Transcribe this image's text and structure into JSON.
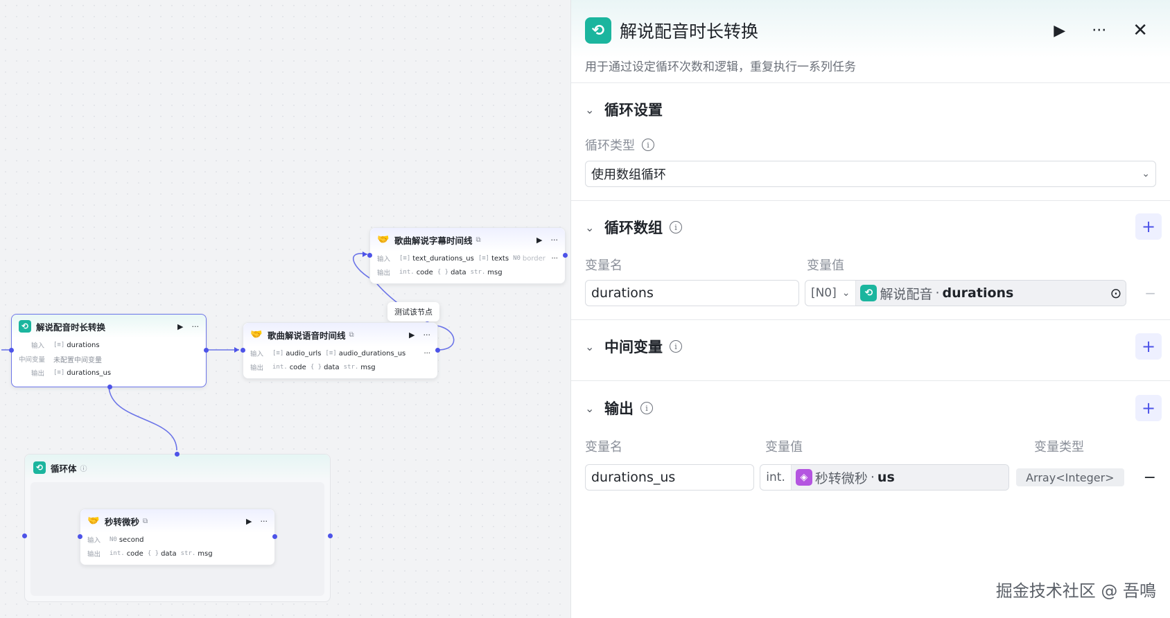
{
  "canvas": {
    "tooltip": "测试该节点",
    "nodes": {
      "subtitle": {
        "title": "歌曲解说字幕时间线",
        "in_label": "输入",
        "out_label": "输出",
        "inputs": [
          {
            "type": "[≡]",
            "name": "text_durations_us"
          },
          {
            "type": "[≡]",
            "name": "texts"
          },
          {
            "type": "N0",
            "name": "border"
          }
        ],
        "outputs": [
          {
            "type": "int.",
            "name": "code"
          },
          {
            "type": "{ }",
            "name": "data"
          },
          {
            "type": "str.",
            "name": "msg"
          }
        ]
      },
      "loop": {
        "title": "解说配音时长转换",
        "in_label": "输入",
        "mid_label": "中间变量",
        "out_label": "输出",
        "input": {
          "type": "[≡]",
          "name": "durations"
        },
        "mid_value": "未配置中间变量",
        "output": {
          "type": "[≡]",
          "name": "durations_us"
        }
      },
      "voice": {
        "title": "歌曲解说语音时间线",
        "in_label": "输入",
        "out_label": "输出",
        "inputs": [
          {
            "type": "[≡]",
            "name": "audio_urls"
          },
          {
            "type": "[≡]",
            "name": "audio_durations_us"
          }
        ],
        "outputs": [
          {
            "type": "int.",
            "name": "code"
          },
          {
            "type": "{ }",
            "name": "data"
          },
          {
            "type": "str.",
            "name": "msg"
          }
        ]
      },
      "loop_body": {
        "title": "循环体"
      },
      "sec2us": {
        "title": "秒转微秒",
        "in_label": "输入",
        "out_label": "输出",
        "input": {
          "type": "N0",
          "name": "second"
        },
        "outputs": [
          {
            "type": "int.",
            "name": "code"
          },
          {
            "type": "{ }",
            "name": "data"
          },
          {
            "type": "str.",
            "name": "msg"
          }
        ]
      }
    }
  },
  "panel": {
    "title": "解说配音时长转换",
    "description": "用于通过设定循环次数和逻辑，重复执行一系列任务",
    "loop_settings": {
      "title": "循环设置",
      "type_label": "循环类型",
      "type_value": "使用数组循环"
    },
    "loop_array": {
      "title": "循环数组",
      "col_name": "变量名",
      "col_value": "变量值",
      "var_name": "durations",
      "ref_type": "[N0]",
      "ref_source": "解说配音",
      "ref_sep": " · ",
      "ref_field": "durations"
    },
    "intermediate": {
      "title": "中间变量"
    },
    "output": {
      "title": "输出",
      "col_name": "变量名",
      "col_value": "变量值",
      "col_type": "变量类型",
      "var_name": "durations_us",
      "ref_type": "int.",
      "ref_source": "秒转微秒",
      "ref_sep": " · ",
      "ref_field": "us",
      "var_type": "Array<Integer>"
    }
  },
  "watermark": "掘金技术社区 @ 吾鳴",
  "colors": {
    "accent": "#4d53e8",
    "teal": "#1bb59e",
    "purple": "#b455e0"
  }
}
